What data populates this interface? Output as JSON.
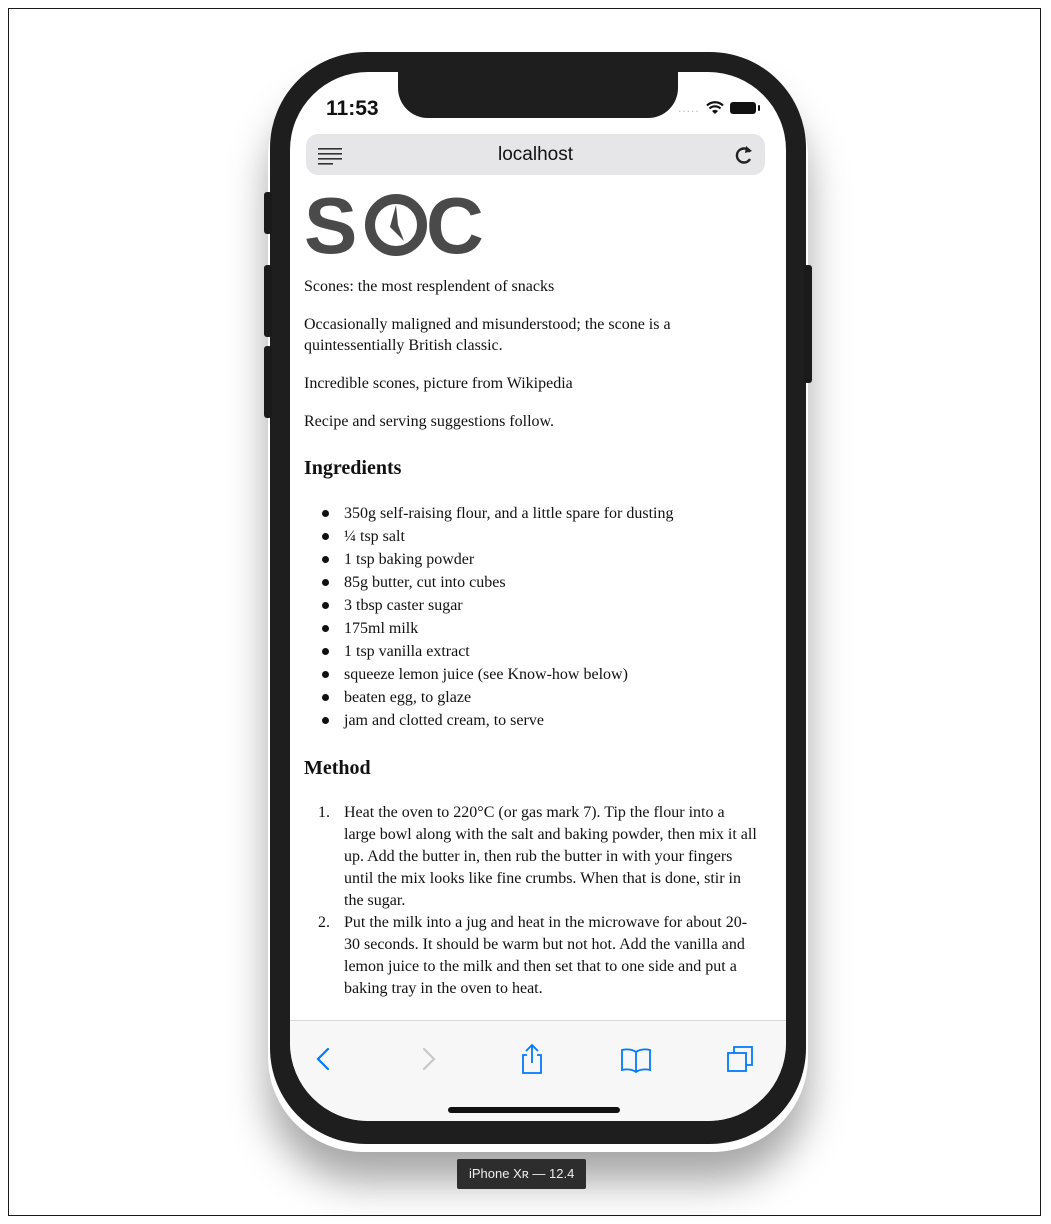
{
  "status": {
    "time": "11:53",
    "signal": "....."
  },
  "browser": {
    "address": "localhost"
  },
  "page": {
    "logo_text": "SOC",
    "tagline": "Scones: the most resplendent of snacks",
    "intro": "Occasionally maligned and misunderstood; the scone is a quintessentially British classic.",
    "caption": "Incredible scones, picture from Wikipedia",
    "follow": "Recipe and serving suggestions follow.",
    "ingredients_heading": "Ingredients",
    "ingredients": [
      "350g self-raising flour, and a little spare for dusting",
      "¼ tsp salt",
      "1 tsp baking powder",
      "85g butter, cut into cubes",
      "3 tbsp caster sugar",
      "175ml milk",
      "1 tsp vanilla extract",
      "squeeze lemon juice (see Know-how below)",
      "beaten egg, to glaze",
      "jam and clotted cream, to serve"
    ],
    "method_heading": "Method",
    "method": [
      {
        "num": "1.",
        "text": "Heat the oven to 220°C (or gas mark 7). Tip the flour into a large bowl along with the salt and baking powder, then mix it all up. Add the butter in, then rub the butter in with your fingers until the mix looks like fine crumbs. When that is done, stir in the sugar."
      },
      {
        "num": "2.",
        "text": "Put the milk into a jug and heat in the microwave for about 20-30 seconds. It should be warm but not hot. Add the vanilla and lemon juice to the milk and then set that to one side and put a baking tray in the oven to heat."
      }
    ]
  },
  "toolbar": {
    "icons": [
      "back-icon",
      "forward-icon",
      "share-icon",
      "bookmarks-icon",
      "tabs-icon"
    ],
    "accent": "#007aff",
    "disabled": "#c7c7cc"
  },
  "simulator_label": "iPhone Xʀ — 12.4"
}
